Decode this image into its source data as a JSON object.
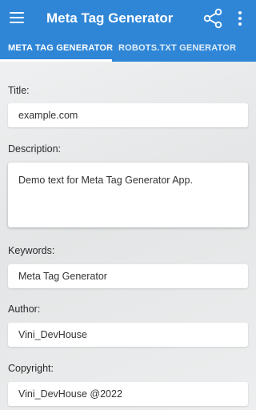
{
  "appbar": {
    "title": "Meta Tag Generator"
  },
  "tabs": [
    {
      "label": "META TAG GENERATOR",
      "selected": true
    },
    {
      "label": "ROBOTS.TXT GENERATOR",
      "selected": false
    }
  ],
  "form": {
    "title": {
      "label": "Title:",
      "value": "example.com"
    },
    "description": {
      "label": "Description:",
      "value": "Demo text for Meta Tag Generator App."
    },
    "keywords": {
      "label": "Keywords:",
      "value": "Meta Tag Generator"
    },
    "author": {
      "label": "Author:",
      "value": "Vini_DevHouse"
    },
    "copyright": {
      "label": "Copyright:",
      "value": "Vini_DevHouse @2022"
    }
  },
  "colors": {
    "primary": "#2f86d6",
    "background": "#e6e7e8"
  }
}
